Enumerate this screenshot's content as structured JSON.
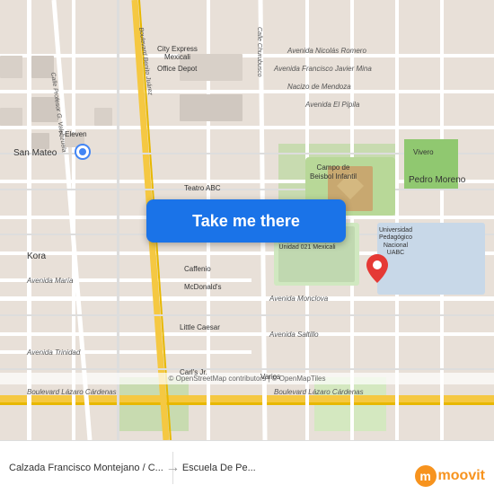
{
  "map": {
    "attribution": "© OpenStreetMap contributors | © OpenMapTiles",
    "center": {
      "lat": 32.62,
      "lon": -115.47
    }
  },
  "button": {
    "label": "Take me there"
  },
  "bottom": {
    "left_label": "Calzada Francisco Montejano / C...",
    "right_label": "Escuela De Pe...",
    "separator": "→",
    "attribution": "© OpenStreetMap contributors | © OpenMapTiles"
  },
  "moovit": {
    "logo_letter": "m",
    "logo_text": "moovit"
  },
  "labels": {
    "avenidasNicolasRomero": "Avenida Nicolás Romero",
    "avenidaFranciscoJavierMina": "Avenida Francisco Javier Mina",
    "nacizoDeMendoza": "Nacizo de Mendoza",
    "avenidaElPipila": "Avenida El Pípila",
    "sanMateo": "San Mateo",
    "pedroMoreno": "Pedro Moreno",
    "kora": "Kora",
    "avenidaMaria": "Avenida María",
    "avenidaTrinidad": "Avenida Trinidad",
    "avenidaMonclova": "Avenida Monclova",
    "avenidaSaltillo": "Avenida Saltillo",
    "boulevardLazaroCardenas": "Boulevard Lázaro Cárdenas",
    "boulevardLazaroCardenas2": "Boulevard Lázaro Cárdenas",
    "universidadPedagogica": "Universidad Pedagogica Nacional, Unidad 021 Mexicali",
    "uabc": "Universidad\nPedagógico\nNacional\nUABC",
    "teatro": "Teatro ABC",
    "campoBeis": "Campo de\nBeisobol Infantil",
    "vivero": "Vivero",
    "caffenio": "Caffenio",
    "mcdonalds": "McDonald's",
    "littleCaesar": "Little Caesar",
    "carlsJr": "Carl's Jr.",
    "varios": "Varios",
    "cityExpressMexicali": "City Express\nMexicali",
    "officeDepot": "Office Depot",
    "sevenEleven": "7-Eleven",
    "calleProfesorGValenzuela": "Calle Profesor G. Valenzuela",
    "boulevardBenitoJuarez": "Boulevard Benito Juárez",
    "calleChurubusco": "Calle Churubusco"
  },
  "pin": {
    "color": "#e53935"
  },
  "blueDot": {
    "color": "#4285f4"
  }
}
